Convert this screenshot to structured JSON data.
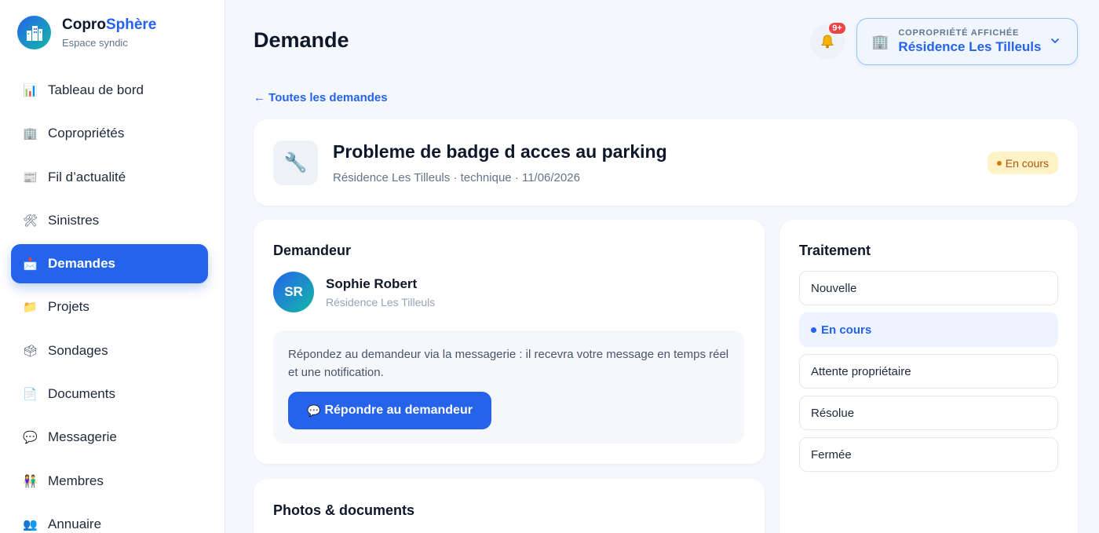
{
  "brand": {
    "title_main": "Copro",
    "title_accent": "Sphère",
    "subtitle": "Espace syndic"
  },
  "sidebar": {
    "items": [
      {
        "label": "Tableau de bord",
        "icon": "📊"
      },
      {
        "label": "Copropriétés",
        "icon": "🏢"
      },
      {
        "label": "Fil d’actualité",
        "icon": "📰"
      },
      {
        "label": "Sinistres",
        "icon": "🛠"
      },
      {
        "label": "Demandes",
        "icon": "📩"
      },
      {
        "label": "Projets",
        "icon": "📁"
      },
      {
        "label": "Sondages",
        "icon": "🗳"
      },
      {
        "label": "Documents",
        "icon": "📄"
      },
      {
        "label": "Messagerie",
        "icon": "💬"
      },
      {
        "label": "Membres",
        "icon": "👫"
      },
      {
        "label": "Annuaire",
        "icon": "👥"
      }
    ],
    "active_index": 4
  },
  "header": {
    "title": "Demande",
    "notifications_badge": "9+",
    "copro_caption": "COPROPRIÉTÉ AFFICHÉE",
    "copro_value": "Résidence Les Tilleuls"
  },
  "back_link": "← Toutes les demandes",
  "request": {
    "icon": "🔧",
    "title": "Probleme de badge d acces au parking",
    "meta": "Résidence Les Tilleuls · technique · 11/06/2026",
    "status": "En cours"
  },
  "requester": {
    "section_title": "Demandeur",
    "initials": "SR",
    "name": "Sophie Robert",
    "residence": "Résidence Les Tilleuls",
    "info": "Répondez au demandeur via la messagerie : il recevra votre message en temps réel et une notification.",
    "reply_label": "Répondre au demandeur",
    "reply_icon": "💬"
  },
  "photos": {
    "section_title": "Photos & documents"
  },
  "treatment": {
    "section_title": "Traitement",
    "options": [
      "Nouvelle",
      "En cours",
      "Attente propriétaire",
      "Résolue",
      "Fermée"
    ],
    "current_index": 1
  },
  "colors": {
    "accent": "#2563eb",
    "status_bg": "#fef3c7",
    "status_text": "#b45309"
  }
}
